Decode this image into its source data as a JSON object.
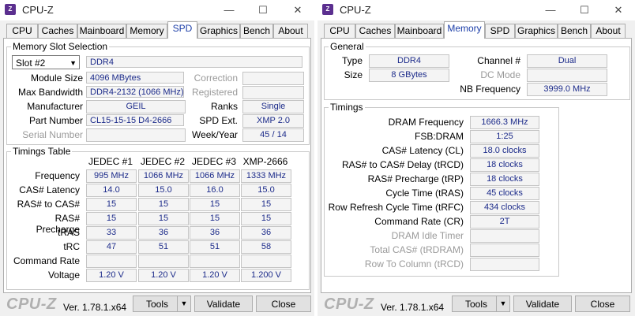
{
  "w1": {
    "title": "CPU-Z",
    "tabs": [
      "CPU",
      "Caches",
      "Mainboard",
      "Memory",
      "SPD",
      "Graphics",
      "Bench",
      "About"
    ],
    "slot": {
      "group_title": "Memory Slot Selection",
      "slot_value": "Slot #2",
      "type": "DDR4",
      "module_size_label": "Module Size",
      "module_size": "4096 MBytes",
      "max_bw_label": "Max Bandwidth",
      "max_bw": "DDR4-2132 (1066 MHz)",
      "manufacturer_label": "Manufacturer",
      "manufacturer": "GEIL",
      "part_label": "Part Number",
      "part": "CL15-15-15 D4-2666",
      "serial_label": "Serial Number",
      "serial": "",
      "correction_label": "Correction",
      "correction": "",
      "registered_label": "Registered",
      "registered": "",
      "ranks_label": "Ranks",
      "ranks": "Single",
      "spd_ext_label": "SPD Ext.",
      "spd_ext": "XMP 2.0",
      "week_year_label": "Week/Year",
      "week_year": "45 / 14"
    },
    "timings": {
      "group_title": "Timings Table",
      "columns": [
        "JEDEC #1",
        "JEDEC #2",
        "JEDEC #3",
        "XMP-2666"
      ],
      "rows": [
        {
          "label": "Frequency",
          "values": [
            "995 MHz",
            "1066 MHz",
            "1066 MHz",
            "1333 MHz"
          ]
        },
        {
          "label": "CAS# Latency",
          "values": [
            "14.0",
            "15.0",
            "16.0",
            "15.0"
          ]
        },
        {
          "label": "RAS# to CAS#",
          "values": [
            "15",
            "15",
            "15",
            "15"
          ]
        },
        {
          "label": "RAS# Precharge",
          "values": [
            "15",
            "15",
            "15",
            "15"
          ]
        },
        {
          "label": "tRAS",
          "values": [
            "33",
            "36",
            "36",
            "36"
          ]
        },
        {
          "label": "tRC",
          "values": [
            "47",
            "51",
            "51",
            "58"
          ]
        },
        {
          "label": "Command Rate",
          "values": [
            "",
            "",
            "",
            ""
          ]
        },
        {
          "label": "Voltage",
          "values": [
            "1.20 V",
            "1.20 V",
            "1.20 V",
            "1.200 V"
          ]
        }
      ]
    },
    "footer": {
      "brand": "CPU-Z",
      "version": "Ver. 1.78.1.x64",
      "tools": "Tools",
      "validate": "Validate",
      "close": "Close"
    }
  },
  "w2": {
    "title": "CPU-Z",
    "tabs": [
      "CPU",
      "Caches",
      "Mainboard",
      "Memory",
      "SPD",
      "Graphics",
      "Bench",
      "About"
    ],
    "general": {
      "group_title": "General",
      "type_label": "Type",
      "type": "DDR4",
      "size_label": "Size",
      "size": "8 GBytes",
      "channel_label": "Channel #",
      "channel": "Dual",
      "dc_mode_label": "DC Mode",
      "dc_mode": "",
      "nb_freq_label": "NB Frequency",
      "nb_freq": "3999.0 MHz"
    },
    "timings": {
      "group_title": "Timings",
      "rows": [
        {
          "label": "DRAM Frequency",
          "value": "1666.3 MHz",
          "dim": false
        },
        {
          "label": "FSB:DRAM",
          "value": "1:25",
          "dim": false
        },
        {
          "label": "CAS# Latency (CL)",
          "value": "18.0 clocks",
          "dim": false
        },
        {
          "label": "RAS# to CAS# Delay (tRCD)",
          "value": "18 clocks",
          "dim": false
        },
        {
          "label": "RAS# Precharge (tRP)",
          "value": "18 clocks",
          "dim": false
        },
        {
          "label": "Cycle Time (tRAS)",
          "value": "45 clocks",
          "dim": false
        },
        {
          "label": "Row Refresh Cycle Time (tRFC)",
          "value": "434 clocks",
          "dim": false
        },
        {
          "label": "Command Rate (CR)",
          "value": "2T",
          "dim": false
        },
        {
          "label": "DRAM Idle Timer",
          "value": "",
          "dim": true
        },
        {
          "label": "Total CAS# (tRDRAM)",
          "value": "",
          "dim": true
        },
        {
          "label": "Row To Column (tRCD)",
          "value": "",
          "dim": true
        }
      ]
    },
    "footer": {
      "brand": "CPU-Z",
      "version": "Ver. 1.78.1.x64",
      "tools": "Tools",
      "validate": "Validate",
      "close": "Close"
    }
  },
  "colors": {
    "value_text": "#1c2b8a",
    "active_tab_text": "#1c3ea8",
    "brand_gray": "#b0b0b0"
  }
}
